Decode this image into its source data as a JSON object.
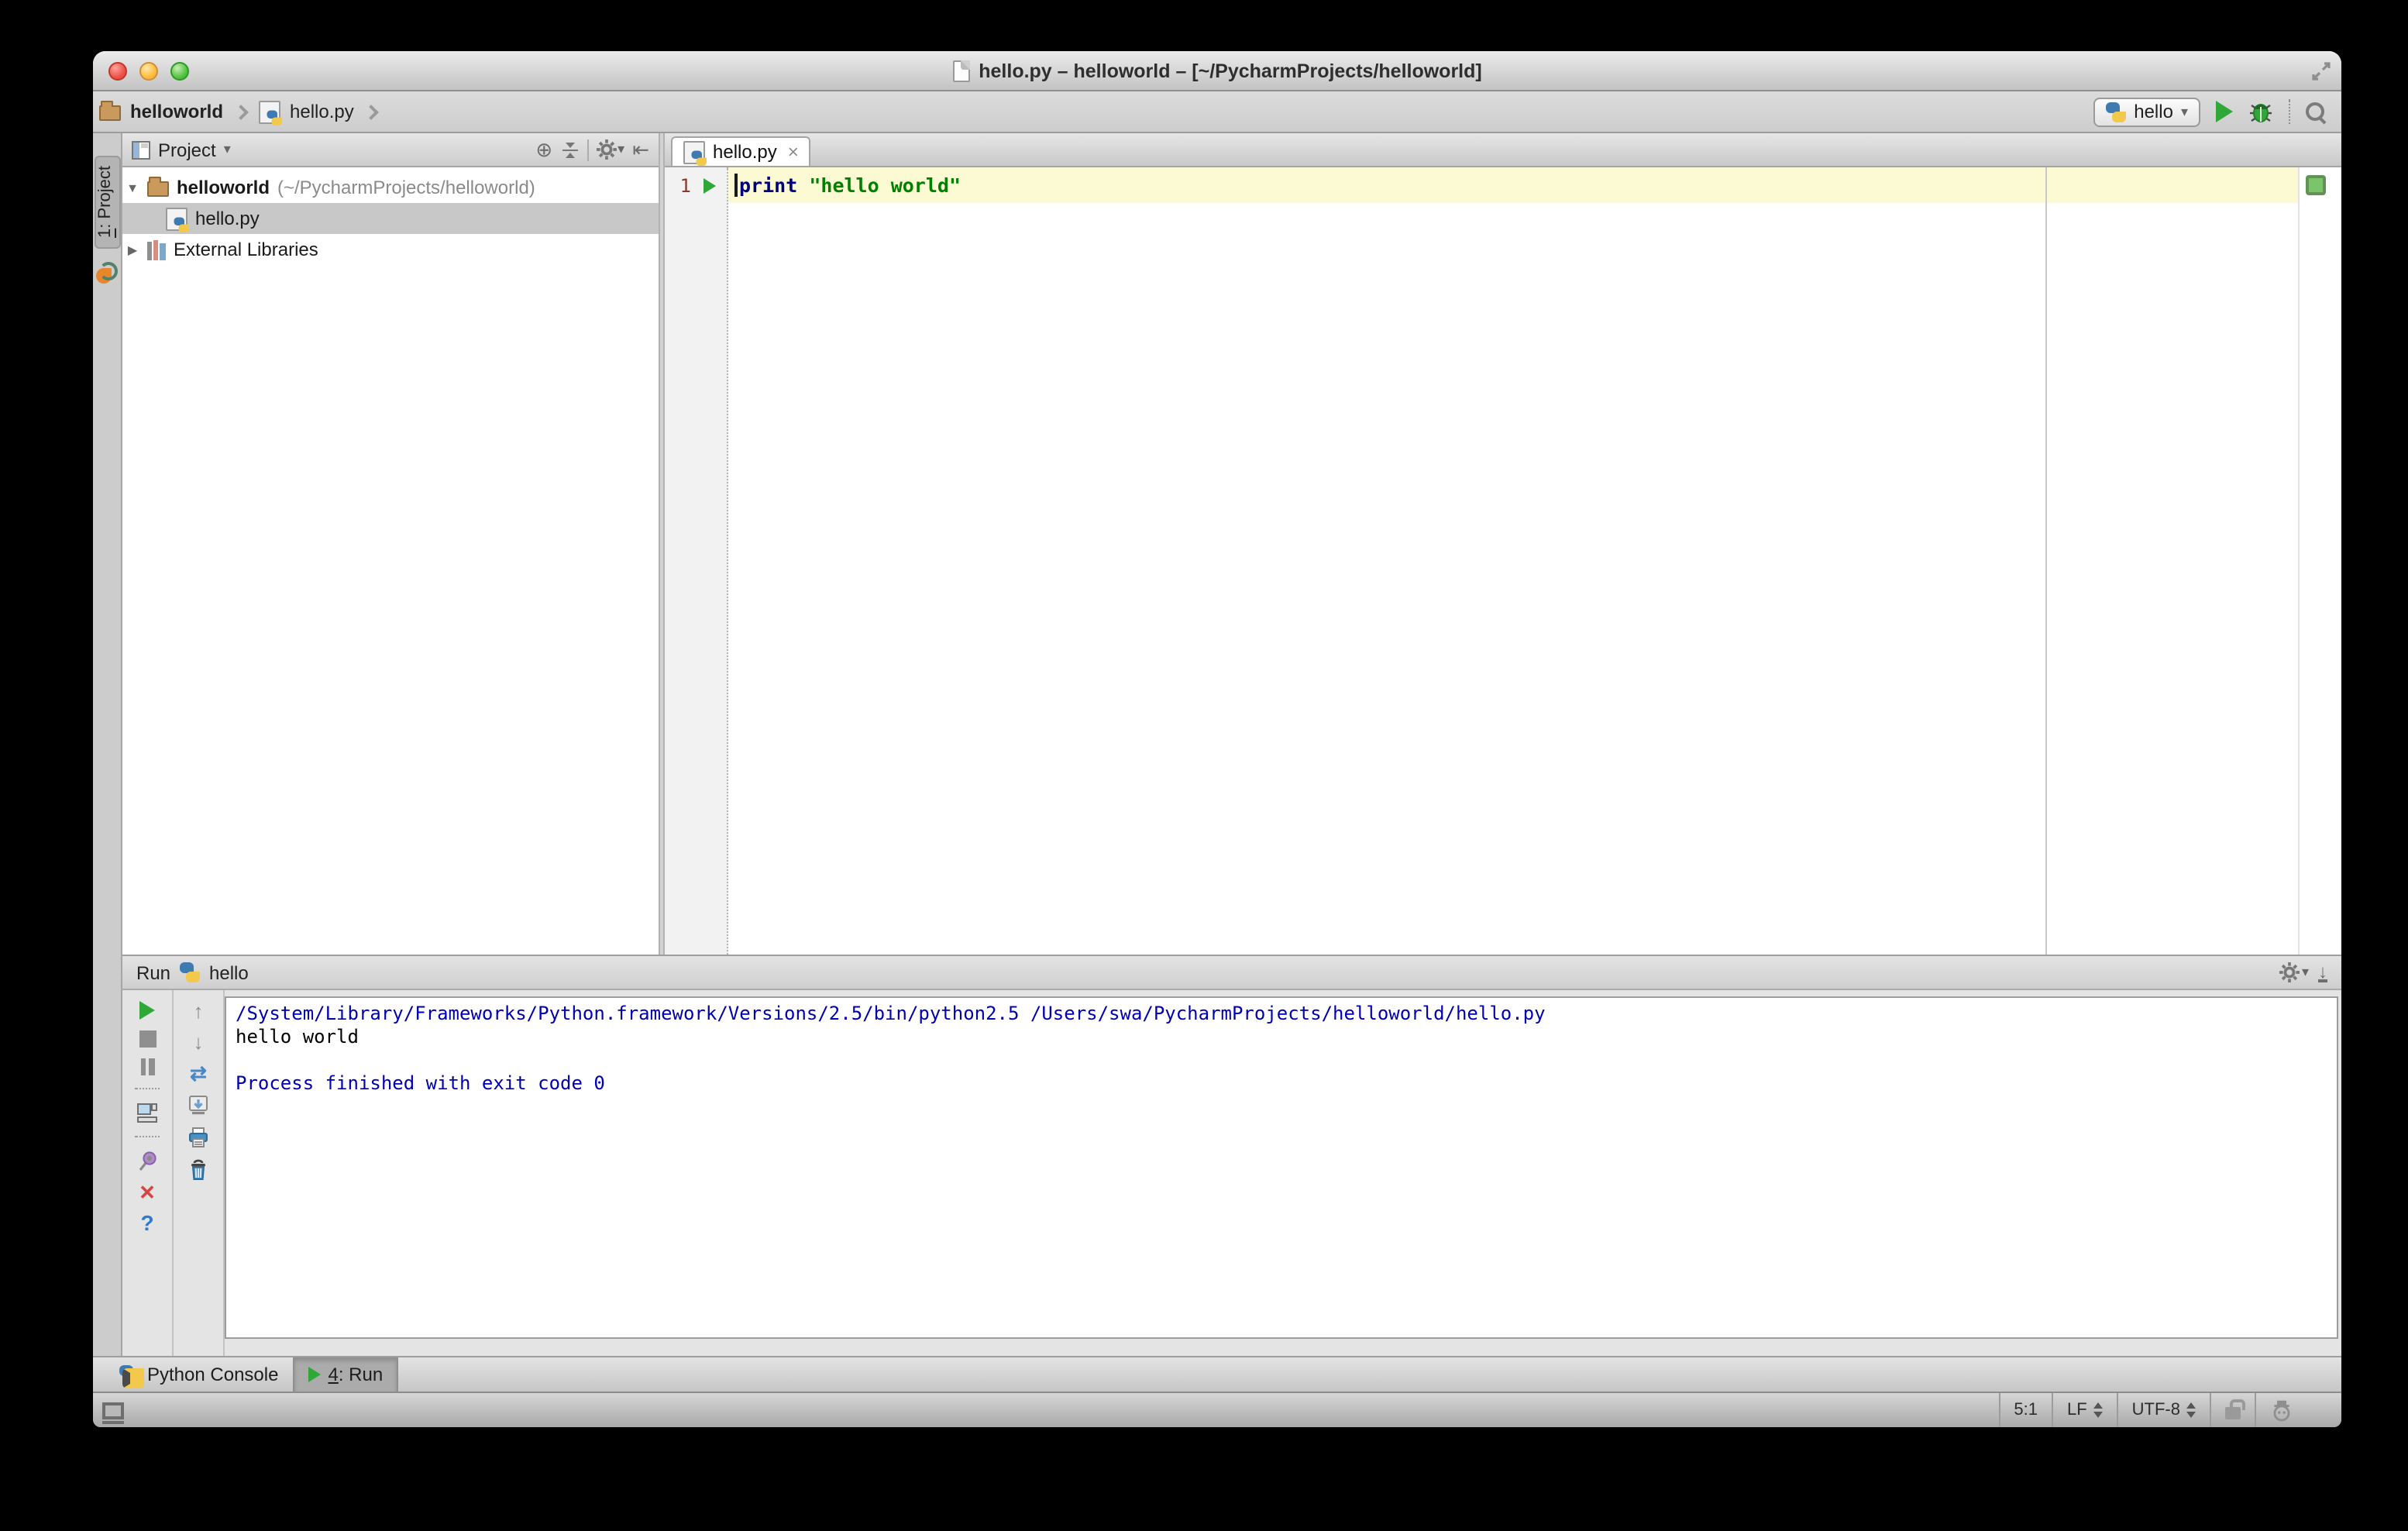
{
  "window": {
    "title": "hello.py – helloworld – [~/PycharmProjects/helloworld]"
  },
  "main_toolbar": {
    "breadcrumbs": [
      {
        "label": "helloworld"
      },
      {
        "label": "hello.py"
      }
    ],
    "run_config_label": "hello"
  },
  "tool_stripe": {
    "project_number": "1",
    "project_label": ": Project"
  },
  "project_panel": {
    "header_label": "Project",
    "tree": [
      {
        "name": "helloworld",
        "path": "(~/PycharmProjects/helloworld)"
      },
      {
        "name": "hello.py"
      },
      {
        "name": "External Libraries"
      }
    ]
  },
  "editor": {
    "tab_label": "hello.py",
    "line_number": "1",
    "code": {
      "keyword": "print",
      "string": "\"hello world\""
    }
  },
  "run_panel": {
    "title": "Run",
    "tab_label": "hello",
    "console_lines": [
      {
        "text": "/System/Library/Frameworks/Python.framework/Versions/2.5/bin/python2.5 /Users/swa/PycharmProjects/helloworld/hello.py",
        "type": "system"
      },
      {
        "text": "hello world",
        "type": "stdout"
      },
      {
        "text": "",
        "type": "blank"
      },
      {
        "text": "Process finished with exit code 0",
        "type": "system"
      }
    ]
  },
  "bottom_bar": {
    "python_console_label": "Python Console",
    "run_tab_number": "4",
    "run_tab_rest": ": Run"
  },
  "status_bar": {
    "caret_position": "5:1",
    "line_ending": "LF",
    "encoding": "UTF-8"
  },
  "colors": {
    "run_green": "#2fa838",
    "keyword_blue": "#000080",
    "string_green": "#008000",
    "console_info_blue": "#0000b2",
    "current_line_yellow": "#fcfad2",
    "inspection_ok_green": "#7cc46a",
    "selection_gray": "#c8c8c8"
  },
  "glyphs": {
    "dropdown": "▾",
    "tree_expanded": "▼",
    "tree_collapsed": "▶",
    "tab_close": "×",
    "locate_target": "⊕",
    "hide_panel_left": "⇤",
    "arrow_up": "↑",
    "arrow_down": "↓",
    "soft_wrap": "⇄",
    "close_x": "✕",
    "help": "?",
    "hide_panel_down": "↓"
  }
}
